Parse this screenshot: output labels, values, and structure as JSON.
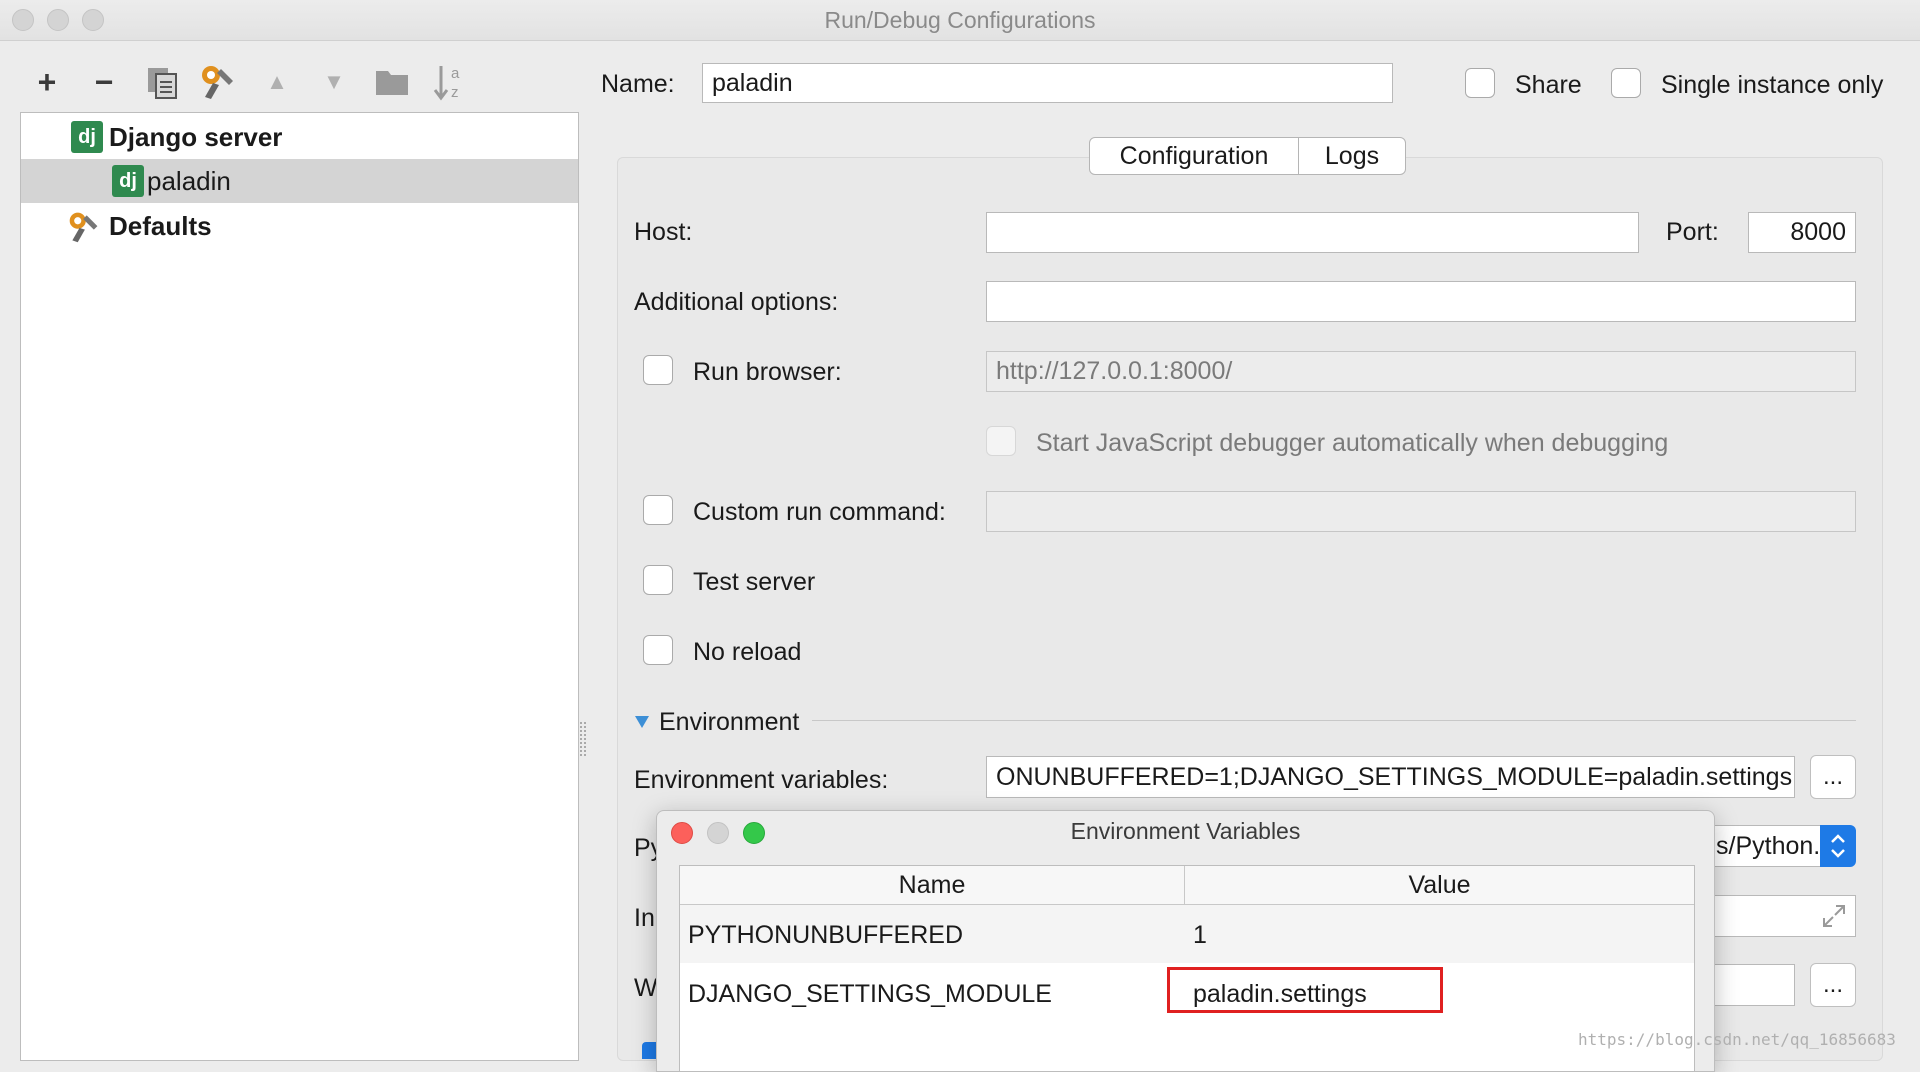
{
  "window": {
    "title": "Run/Debug Configurations"
  },
  "toolbar": {
    "add": "+",
    "remove": "−",
    "copy": "⧉",
    "edit_defaults": "🔧",
    "move_up": "▲",
    "move_down": "▼",
    "folder": "■",
    "sort": "↓"
  },
  "tree": {
    "group_label": "Django server",
    "group_icon": "dj",
    "child_label": "paladin",
    "child_icon": "dj",
    "defaults_label": "Defaults"
  },
  "header": {
    "name_label": "Name:",
    "name_value": "paladin",
    "share_label": "Share",
    "single_instance_label": "Single instance only"
  },
  "tabs": [
    "Configuration",
    "Logs"
  ],
  "form": {
    "host_label": "Host:",
    "host_value": "",
    "port_label": "Port:",
    "port_value": "8000",
    "additional_options_label": "Additional options:",
    "run_browser_label": "Run browser:",
    "run_browser_url": "http://127.0.0.1:8000/",
    "js_debugger_label": "Start JavaScript debugger automatically when debugging",
    "custom_run_label": "Custom run command:",
    "test_server_label": "Test server",
    "no_reload_label": "No reload",
    "environment_section": "Environment",
    "env_vars_label": "Environment variables:",
    "env_vars_value": "ONUNBUFFERED=1;DJANGO_SETTINGS_MODULE=paladin.settings",
    "dots": "...",
    "python_label_partial": "Py",
    "python_value_partial": "s/Python.",
    "interp_label_partial": "In",
    "workdir_label_partial": "W"
  },
  "dialog": {
    "title": "Environment Variables",
    "columns": [
      "Name",
      "Value"
    ],
    "rows": [
      {
        "name": "PYTHONUNBUFFERED",
        "value": "1"
      },
      {
        "name": "DJANGO_SETTINGS_MODULE",
        "value": "paladin.settings"
      }
    ]
  },
  "watermark": "https://blog.csdn.net/qq_16856683",
  "colors": {
    "highlight": "#e02020",
    "accent": "#1e7ae6",
    "close": "#fc605b",
    "minimize": "#fdbc40",
    "zoom": "#34c84a"
  }
}
